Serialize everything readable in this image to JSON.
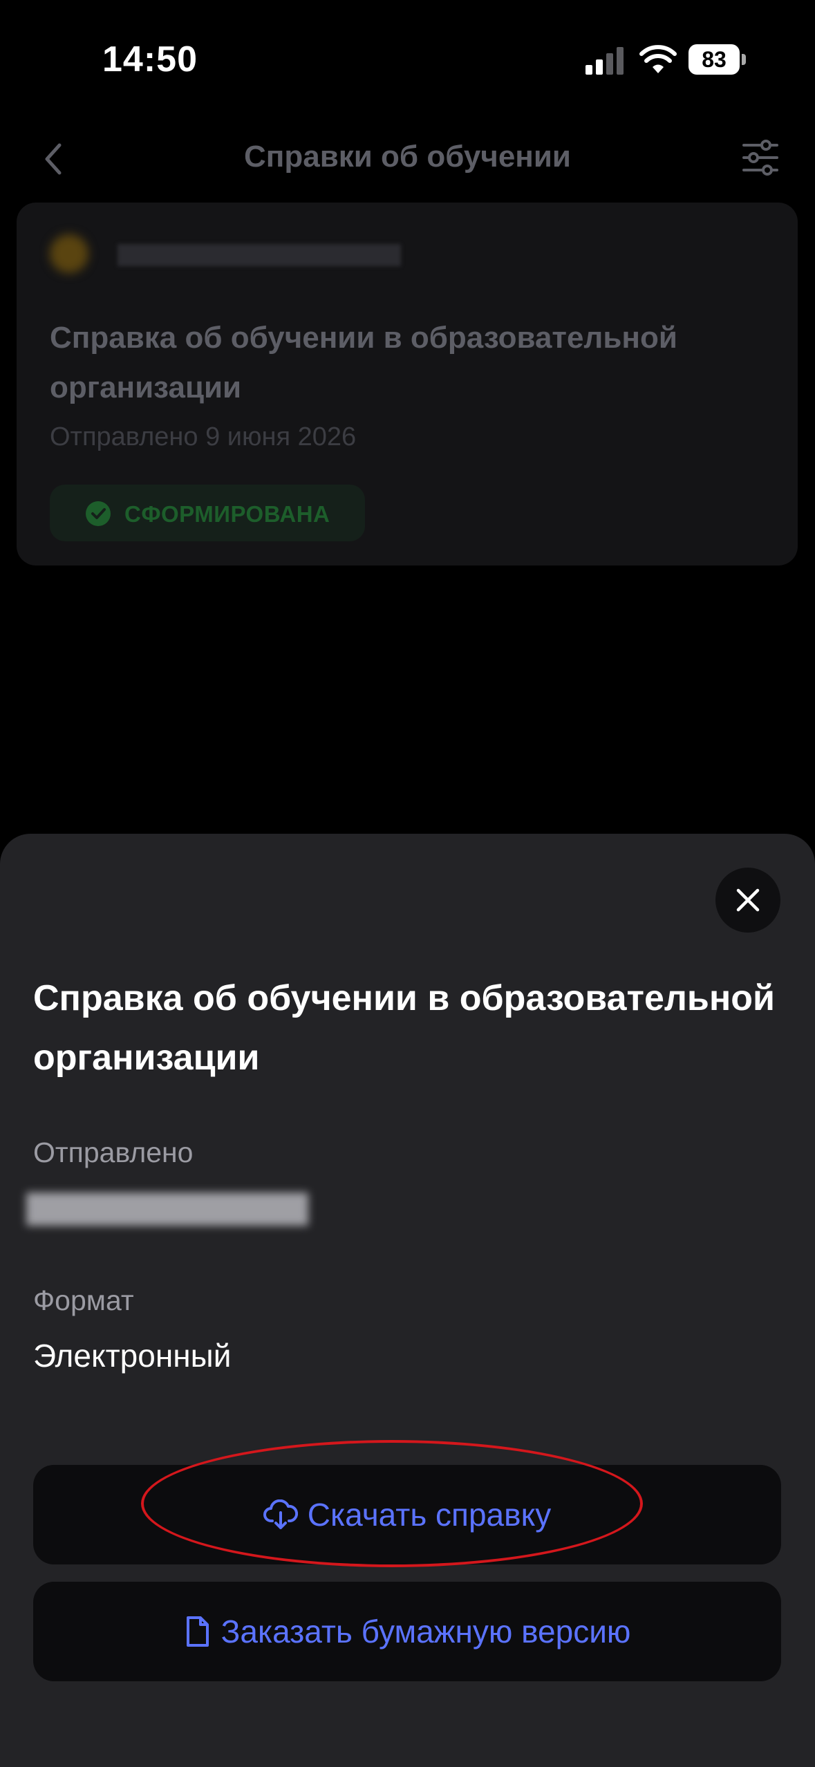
{
  "status_bar": {
    "time": "14:50",
    "battery": "83"
  },
  "nav": {
    "title": "Справки об обучении",
    "back_icon": "chevron-left-icon",
    "filter_icon": "sliders-icon"
  },
  "card": {
    "title": "Справка об обучении в образовательной организации",
    "date": "Отправлено 9 июня 2026",
    "status": "СФОРМИРОВАНА",
    "status_color": "#1d5e2b"
  },
  "sheet": {
    "title": "Справка об обучении в образовательной организации",
    "sent_label": "Отправлено",
    "format_label": "Формат",
    "format_value": "Электронный",
    "download_label": "Скачать справку",
    "paper_label": "Заказать бумажную версию",
    "accent_color": "#5b73ff"
  }
}
